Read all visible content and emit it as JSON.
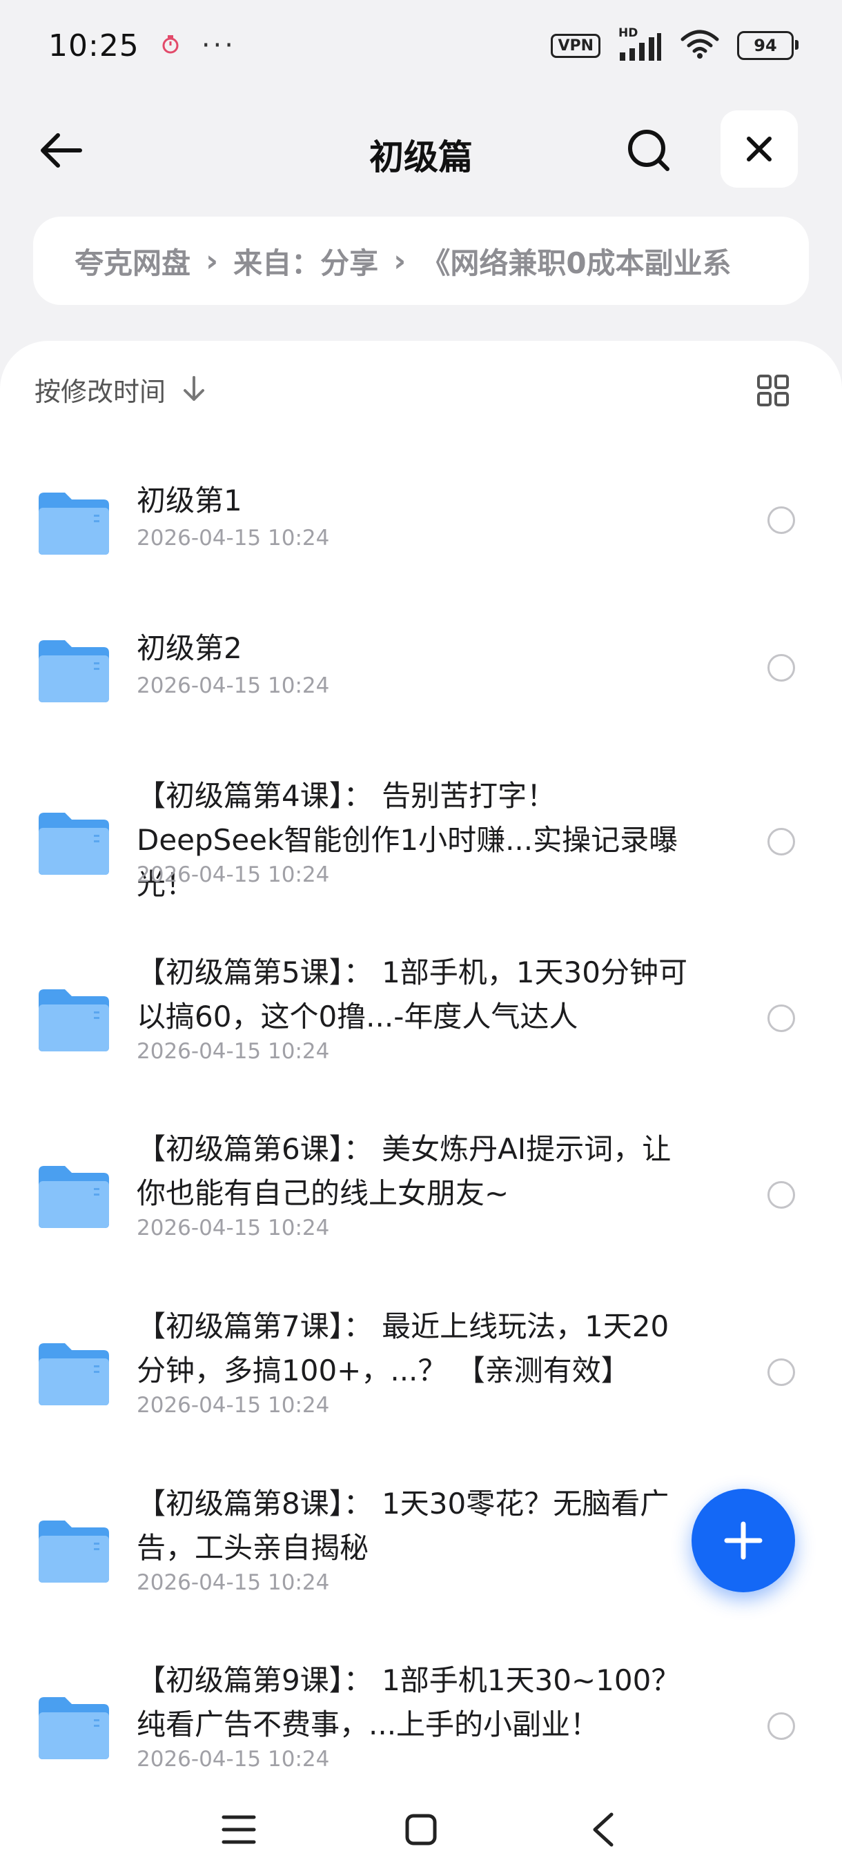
{
  "status_bar": {
    "time": "10:25",
    "more": "···",
    "vpn": "VPN",
    "hd": "HD",
    "battery": "94"
  },
  "header": {
    "title": "初级篇"
  },
  "breadcrumb": {
    "items": [
      "夸克网盘",
      "来自：分享",
      "《网络兼职0成本副业系"
    ]
  },
  "sort": {
    "label": "按修改时间"
  },
  "files": [
    {
      "name": "初级第1",
      "date": "2026-04-15 10:24"
    },
    {
      "name": "初级第2",
      "date": "2026-04-15 10:24"
    },
    {
      "name": "【初级篇第4课】： 告别苦打字！DeepSeek智能创作1小时赚...实操记录曝光！",
      "date": "2026-04-15 10:24"
    },
    {
      "name": "【初级篇第5课】： 1部手机，1天30分钟可以搞60，这个0撸...-年度人气达人",
      "date": "2026-04-15 10:24"
    },
    {
      "name": "【初级篇第6课】： 美女炼丹AI提示词，让你也能有自己的线上女朋友~",
      "date": "2026-04-15 10:24"
    },
    {
      "name": "【初级篇第7课】： 最近上线玩法，1天20分钟，多搞100+，...？ 【亲测有效】",
      "date": "2026-04-15 10:24"
    },
    {
      "name": "【初级篇第8课】： 1天30零花？无脑看广告，工头亲自揭秘",
      "date": "2026-04-15 10:24"
    },
    {
      "name": "【初级篇第9课】： 1部手机1天30~100？纯看广告不费事，...上手的小副业！",
      "date": "2026-04-15 10:24"
    }
  ],
  "colors": {
    "accent": "#1468f6",
    "folder": "#6fb3f7",
    "background": "#f2f2f4"
  }
}
